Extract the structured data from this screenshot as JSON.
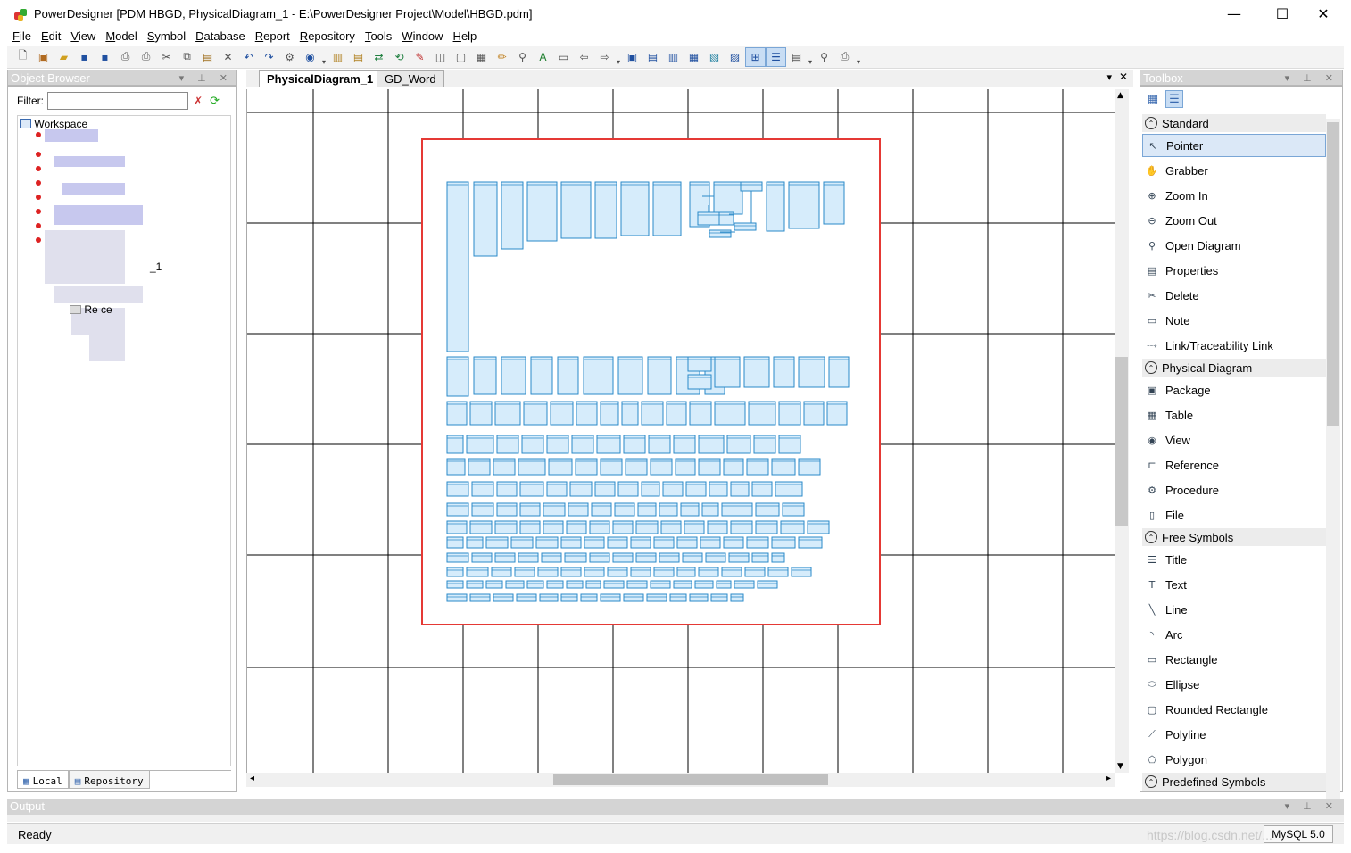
{
  "window": {
    "title": "PowerDesigner [PDM HBGD, PhysicalDiagram_1 - E:\\PowerDesigner Project\\Model\\HBGD.pdm]",
    "minimize": "—",
    "maximize": "☐",
    "close": "✕"
  },
  "menu": [
    {
      "key": "F",
      "rest": "ile"
    },
    {
      "key": "E",
      "rest": "dit"
    },
    {
      "key": "V",
      "rest": "iew"
    },
    {
      "key": "M",
      "rest": "odel"
    },
    {
      "key": "S",
      "rest": "ymbol"
    },
    {
      "key": "D",
      "rest": "atabase"
    },
    {
      "key": "R",
      "rest": "eport"
    },
    {
      "key": "R",
      "rest": "epository"
    },
    {
      "key": "T",
      "rest": "ools"
    },
    {
      "key": "W",
      "rest": "indow"
    },
    {
      "key": "H",
      "rest": "elp"
    }
  ],
  "object_browser": {
    "title": "Object Browser",
    "filter_label": "Filter:",
    "filter_value": "",
    "tree": {
      "workspace": "Workspace",
      "partial_suffix": "_1",
      "reference_partial": "Re        ce"
    },
    "tabs": {
      "local": "Local",
      "repository": "Repository"
    }
  },
  "diagram": {
    "tabs": [
      "PhysicalDiagram_1",
      "GD_Word"
    ],
    "active_tab": "PhysicalDiagram_1",
    "highlight_color": "#e53935"
  },
  "toolbox": {
    "title": "Toolbox",
    "sections": [
      {
        "name": "Standard",
        "items": [
          {
            "label": "Pointer",
            "icon": "pointer-icon",
            "selected": true
          },
          {
            "label": "Grabber",
            "icon": "grabber-icon"
          },
          {
            "label": "Zoom In",
            "icon": "zoom-in-icon"
          },
          {
            "label": "Zoom Out",
            "icon": "zoom-out-icon"
          },
          {
            "label": "Open Diagram",
            "icon": "open-diagram-icon"
          },
          {
            "label": "Properties",
            "icon": "properties-icon"
          },
          {
            "label": "Delete",
            "icon": "delete-icon"
          },
          {
            "label": "Note",
            "icon": "note-icon"
          },
          {
            "label": "Link/Traceability Link",
            "icon": "link-icon"
          }
        ]
      },
      {
        "name": "Physical Diagram",
        "items": [
          {
            "label": "Package",
            "icon": "package-icon"
          },
          {
            "label": "Table",
            "icon": "table-icon"
          },
          {
            "label": "View",
            "icon": "view-icon"
          },
          {
            "label": "Reference",
            "icon": "reference-icon"
          },
          {
            "label": "Procedure",
            "icon": "procedure-icon"
          },
          {
            "label": "File",
            "icon": "file-icon"
          }
        ]
      },
      {
        "name": "Free Symbols",
        "items": [
          {
            "label": "Title",
            "icon": "title-icon"
          },
          {
            "label": "Text",
            "icon": "text-icon"
          },
          {
            "label": "Line",
            "icon": "line-icon"
          },
          {
            "label": "Arc",
            "icon": "arc-icon"
          },
          {
            "label": "Rectangle",
            "icon": "rectangle-icon"
          },
          {
            "label": "Ellipse",
            "icon": "ellipse-icon"
          },
          {
            "label": "Rounded Rectangle",
            "icon": "rounded-rectangle-icon"
          },
          {
            "label": "Polyline",
            "icon": "polyline-icon"
          },
          {
            "label": "Polygon",
            "icon": "polygon-icon"
          }
        ]
      },
      {
        "name": "Predefined Symbols",
        "items": []
      }
    ]
  },
  "output": {
    "title": "Output"
  },
  "status": {
    "text": "Ready",
    "dbms": "MySQL 5.0",
    "watermark": "https://blog.csdn.net/..."
  }
}
